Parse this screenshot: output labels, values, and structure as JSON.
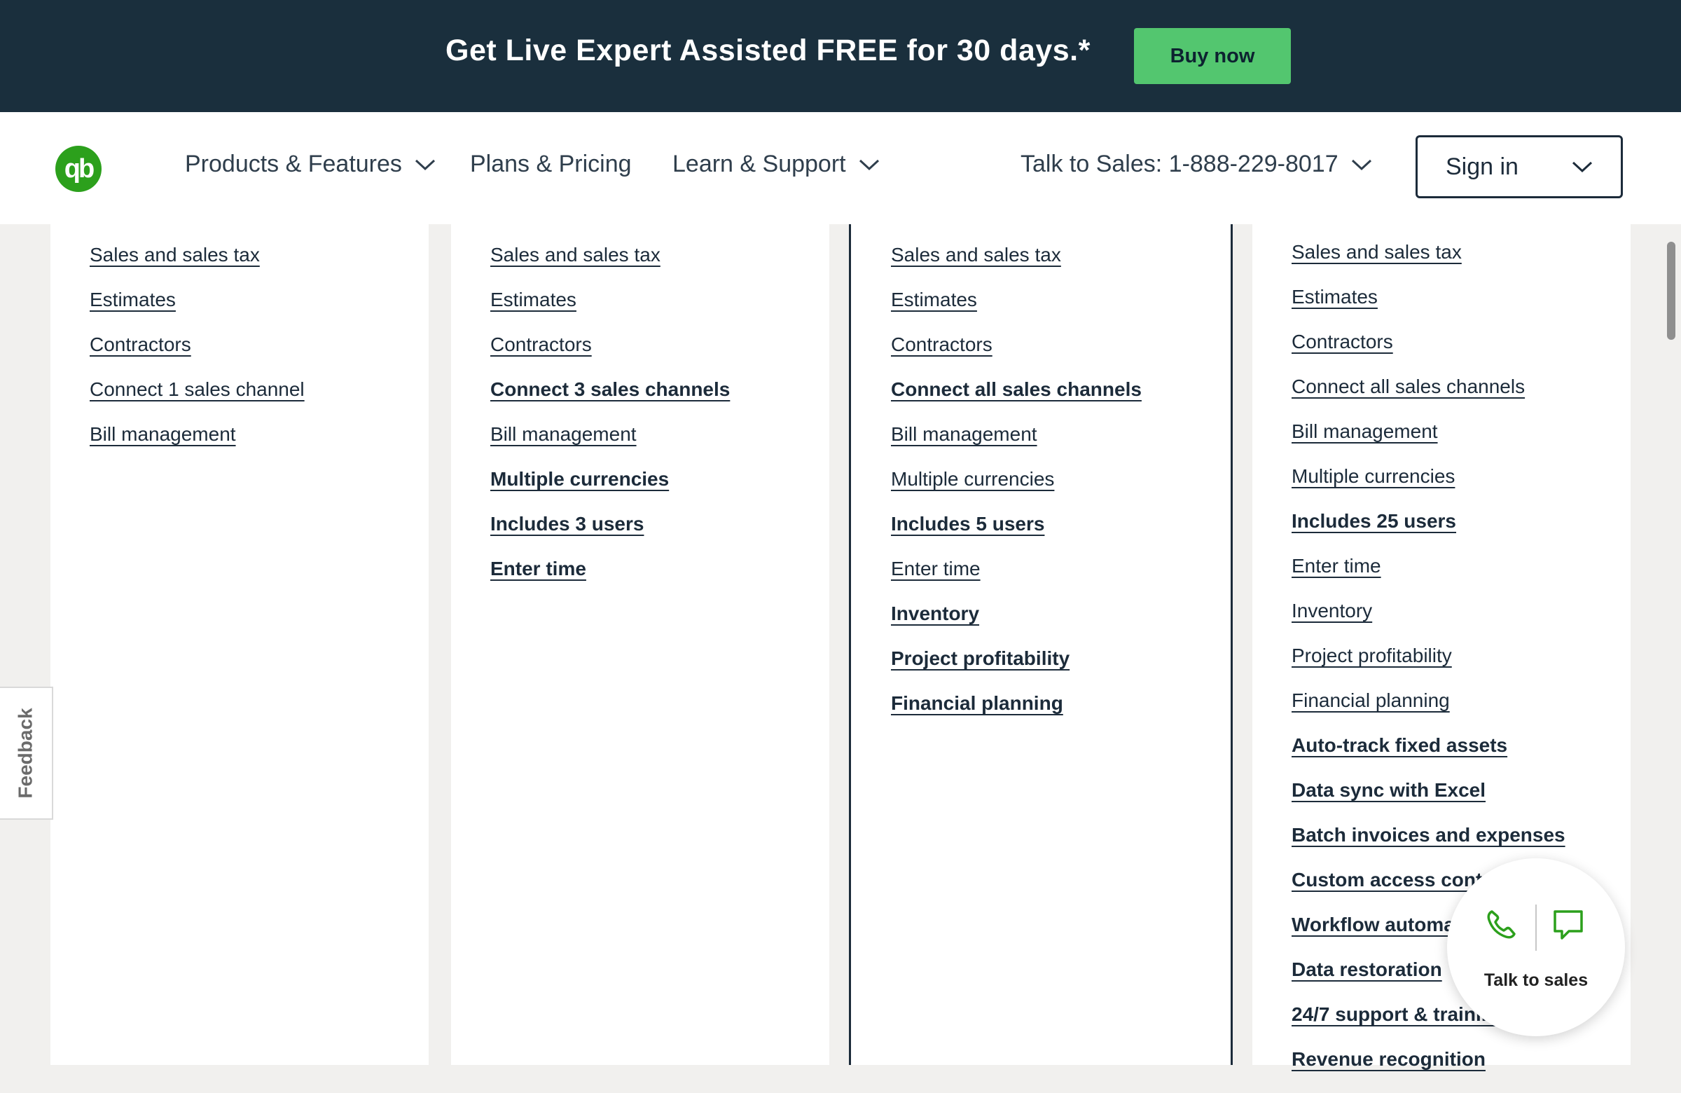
{
  "banner": {
    "text": "Get Live Expert Assisted FREE for 30 days.*",
    "button": "Buy now"
  },
  "nav": {
    "logo": "qb",
    "products": "Products & Features",
    "plans": "Plans & Pricing",
    "learn": "Learn & Support",
    "sales": "Talk to Sales: 1-888-229-8017",
    "signin": "Sign in"
  },
  "columns": [
    {
      "items": [
        {
          "label": "Sales and sales tax",
          "bold": false
        },
        {
          "label": "Estimates",
          "bold": false
        },
        {
          "label": "Contractors",
          "bold": false
        },
        {
          "label": "Connect 1 sales channel",
          "bold": false
        },
        {
          "label": "Bill management",
          "bold": false
        }
      ]
    },
    {
      "items": [
        {
          "label": "Sales and sales tax",
          "bold": false
        },
        {
          "label": "Estimates",
          "bold": false
        },
        {
          "label": "Contractors",
          "bold": false
        },
        {
          "label": "Connect 3 sales channels",
          "bold": true
        },
        {
          "label": "Bill management",
          "bold": false
        },
        {
          "label": "Multiple currencies",
          "bold": true
        },
        {
          "label": "Includes 3 users",
          "bold": true
        },
        {
          "label": "Enter time",
          "bold": true
        }
      ]
    },
    {
      "items": [
        {
          "label": "Sales and sales tax",
          "bold": false
        },
        {
          "label": "Estimates",
          "bold": false
        },
        {
          "label": "Contractors",
          "bold": false
        },
        {
          "label": "Connect all sales channels",
          "bold": true
        },
        {
          "label": "Bill management",
          "bold": false
        },
        {
          "label": "Multiple currencies",
          "bold": false
        },
        {
          "label": "Includes 5 users",
          "bold": true
        },
        {
          "label": "Enter time",
          "bold": false
        },
        {
          "label": "Inventory",
          "bold": true
        },
        {
          "label": "Project profitability",
          "bold": true
        },
        {
          "label": "Financial planning",
          "bold": true
        }
      ]
    },
    {
      "items": [
        {
          "label": "Sales and sales tax",
          "bold": false
        },
        {
          "label": "Estimates",
          "bold": false
        },
        {
          "label": "Contractors",
          "bold": false
        },
        {
          "label": "Connect all sales channels",
          "bold": false
        },
        {
          "label": "Bill management",
          "bold": false
        },
        {
          "label": "Multiple currencies",
          "bold": false
        },
        {
          "label": "Includes 25 users",
          "bold": true
        },
        {
          "label": "Enter time",
          "bold": false
        },
        {
          "label": "Inventory",
          "bold": false
        },
        {
          "label": "Project profitability",
          "bold": false
        },
        {
          "label": "Financial planning",
          "bold": false
        },
        {
          "label": "Auto-track fixed assets",
          "bold": true
        },
        {
          "label": "Data sync with Excel",
          "bold": true
        },
        {
          "label": "Batch invoices and expenses",
          "bold": true
        },
        {
          "label": "Custom access controls",
          "bold": true
        },
        {
          "label": "Workflow automation",
          "bold": true
        },
        {
          "label": "Data restoration",
          "bold": true
        },
        {
          "label": "24/7 support & training",
          "bold": true
        },
        {
          "label": "Revenue recognition",
          "bold": true
        }
      ]
    }
  ],
  "feedback": "Feedback",
  "talk": {
    "label": "Talk to sales",
    "phone_icon": "phone-icon",
    "chat_icon": "chat-bubble-icon"
  },
  "colors": {
    "banner_bg": "#1a2f3d",
    "buy_button": "#53c66f",
    "brand_green": "#2ca01c",
    "text_dark": "#1c2b3a"
  }
}
